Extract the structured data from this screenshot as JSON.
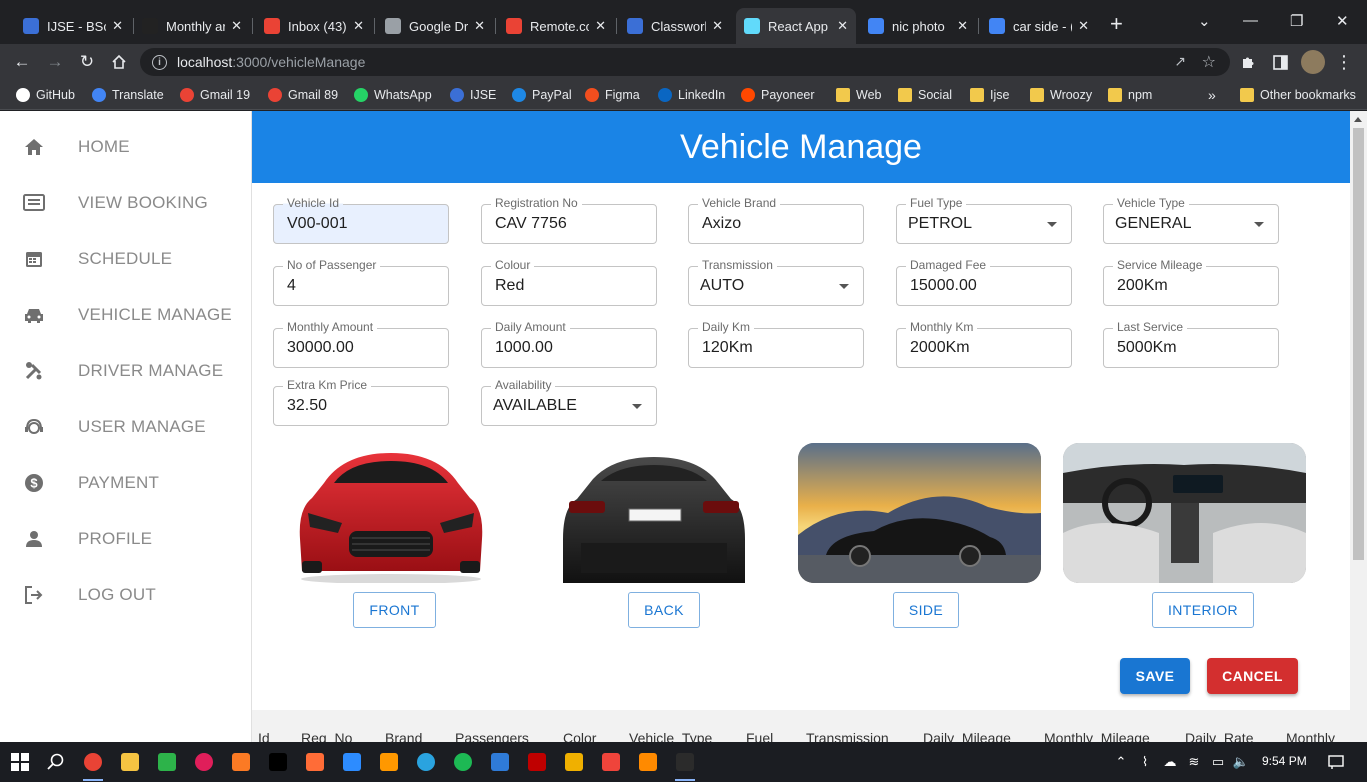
{
  "browser": {
    "tabs": [
      {
        "title": "IJSE - BSc (",
        "icon_color": "#3b6fd6"
      },
      {
        "title": "Monthly ar",
        "icon_color": "#222222"
      },
      {
        "title": "Inbox (43)",
        "icon_color": "#ea4335"
      },
      {
        "title": "Google Dr",
        "icon_color": "#9aa0a6"
      },
      {
        "title": "Remote.co",
        "icon_color": "#ea4335"
      },
      {
        "title": "Classwork",
        "icon_color": "#3b6fd6"
      },
      {
        "title": "React App",
        "icon_color": "#61dafb"
      },
      {
        "title": "nic photo",
        "icon_color": "#4285f4"
      },
      {
        "title": "car side - (",
        "icon_color": "#4285f4"
      }
    ],
    "active_tab": 6,
    "url_host": "localhost",
    "url_path": ":3000/vehicleManage",
    "bookmarks": [
      {
        "label": "GitHub",
        "icon": "github-icon",
        "color": "#ffffff"
      },
      {
        "label": "Translate",
        "icon": "translate-icon",
        "color": "#4285f4"
      },
      {
        "label": "Gmail 19",
        "icon": "gmail-icon",
        "color": "#ea4335"
      },
      {
        "label": "Gmail 89",
        "icon": "gmail-icon",
        "color": "#ea4335"
      },
      {
        "label": "WhatsApp",
        "icon": "whatsapp-icon",
        "color": "#25d366"
      },
      {
        "label": "IJSE",
        "icon": "ijse-icon",
        "color": "#3b6fd6"
      },
      {
        "label": "PayPal",
        "icon": "paypal-icon",
        "color": "#1e88e5"
      },
      {
        "label": "Figma",
        "icon": "figma-icon",
        "color": "#f24e1e"
      },
      {
        "label": "LinkedIn",
        "icon": "linkedin-icon",
        "color": "#0a66c2"
      },
      {
        "label": "Payoneer",
        "icon": "payoneer-icon",
        "color": "#ff4800"
      },
      {
        "label": "Web",
        "icon": "folder-icon",
        "color": "#f2c94c"
      },
      {
        "label": "Social",
        "icon": "folder-icon",
        "color": "#f2c94c"
      },
      {
        "label": "Ijse",
        "icon": "folder-icon",
        "color": "#f2c94c"
      },
      {
        "label": "Wroozy",
        "icon": "folder-icon",
        "color": "#f2c94c"
      },
      {
        "label": "npm",
        "icon": "folder-icon",
        "color": "#f2c94c"
      }
    ],
    "more_bookmarks": "»",
    "other_bookmarks": "Other bookmarks"
  },
  "sidebar": {
    "items": [
      {
        "label": "HOME",
        "icon": "home-icon"
      },
      {
        "label": "VIEW BOOKING",
        "icon": "booking-list-icon"
      },
      {
        "label": "SCHEDULE",
        "icon": "calendar-icon"
      },
      {
        "label": "VEHICLE MANAGE",
        "icon": "car-icon"
      },
      {
        "label": "DRIVER MANAGE",
        "icon": "tools-icon"
      },
      {
        "label": "USER MANAGE",
        "icon": "support-agent-icon"
      },
      {
        "label": "PAYMENT",
        "icon": "dollar-icon"
      },
      {
        "label": "PROFILE",
        "icon": "person-icon"
      },
      {
        "label": "LOG OUT",
        "icon": "logout-icon"
      }
    ]
  },
  "main": {
    "title": "Vehicle Manage",
    "fields": {
      "vehicle_id": {
        "label": "Vehicle Id",
        "value": "V00-001"
      },
      "registration_no": {
        "label": "Registration No",
        "value": "CAV 7756"
      },
      "vehicle_brand": {
        "label": "Vehicle Brand",
        "value": "Axizo"
      },
      "fuel_type": {
        "label": "Fuel Type",
        "value": "PETROL"
      },
      "vehicle_type": {
        "label": "Vehicle Type",
        "value": "GENERAL"
      },
      "no_of_passenger": {
        "label": "No of Passenger",
        "value": "4"
      },
      "colour": {
        "label": "Colour",
        "value": "Red"
      },
      "transmission": {
        "label": "Transmission",
        "value": "AUTO"
      },
      "damaged_fee": {
        "label": "Damaged Fee",
        "value": "15000.00"
      },
      "service_mileage": {
        "label": "Service Mileage",
        "value": "200Km"
      },
      "monthly_amount": {
        "label": "Monthly Amount",
        "value": "30000.00"
      },
      "daily_amount": {
        "label": "Daily Amount",
        "value": "1000.00"
      },
      "daily_km": {
        "label": "Daily Km",
        "value": "120Km"
      },
      "monthly_km": {
        "label": "Monthly Km",
        "value": "2000Km"
      },
      "last_service": {
        "label": "Last Service",
        "value": "5000Km"
      },
      "extra_km_price": {
        "label": "Extra Km Price",
        "value": "32.50"
      },
      "availability": {
        "label": "Availability",
        "value": "AVAILABLE"
      }
    },
    "image_buttons": {
      "front": "FRONT",
      "back": "BACK",
      "side": "SIDE",
      "interior": "INTERIOR"
    },
    "save_label": "SAVE",
    "cancel_label": "CANCEL",
    "table_headers": [
      "Id",
      "Reg_No",
      "Brand",
      "Passengers",
      "Color",
      "Vehicle_Type",
      "Fuel",
      "Transmission",
      "Daily_Mileage",
      "Monthly_Mileage",
      "Daily_Rate",
      "Monthly_"
    ]
  },
  "taskbar": {
    "time": "9:54 PM"
  },
  "colors": {
    "header": "#1a84e6",
    "save": "#1976d2",
    "cancel": "#d32f2f",
    "sidebar_text": "#8a8a8a"
  }
}
